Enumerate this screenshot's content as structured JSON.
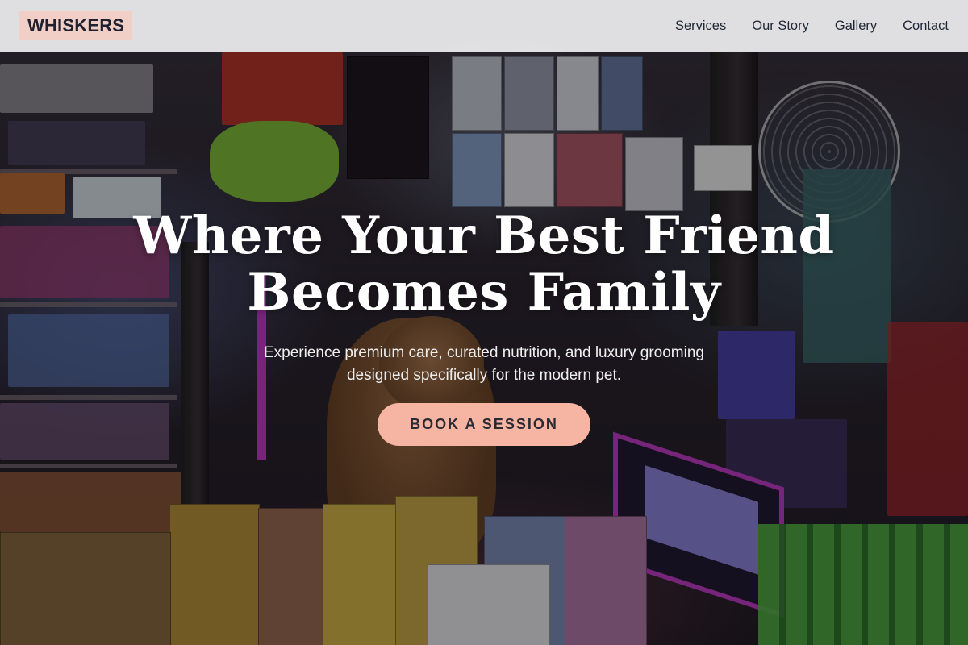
{
  "brand": {
    "logo_text": "WHISKERS",
    "accent": "#f6b4a2"
  },
  "nav": {
    "items": [
      {
        "label": "Services"
      },
      {
        "label": "Our Story"
      },
      {
        "label": "Gallery"
      },
      {
        "label": "Contact"
      }
    ]
  },
  "hero": {
    "headline_line1": "Where Your Best Friend",
    "headline_line2": "Becomes Family",
    "subheadline_line1": "Experience premium care, curated nutrition, and luxury grooming",
    "subheadline_line2": "designed specifically for the modern pet.",
    "cta_label": "BOOK A SESSION"
  }
}
